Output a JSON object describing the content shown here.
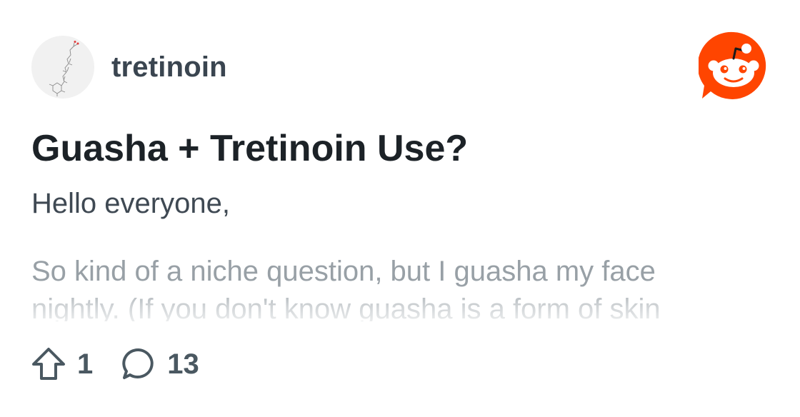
{
  "community": {
    "name": "tretinoin",
    "avatar_icon": "molecule-structure-icon"
  },
  "brand": {
    "icon": "reddit-logo-icon",
    "accent": "#ff4500"
  },
  "post": {
    "title": "Guasha + Tretinoin Use?",
    "greeting": "Hello everyone,",
    "excerpt": "So kind of a niche question, but I guasha my face nightly. (If you don't know guasha is a form of skin"
  },
  "actions": {
    "upvote_icon": "upvote-arrow-icon",
    "upvotes": "1",
    "comment_icon": "comment-bubble-icon",
    "comments": "13"
  }
}
